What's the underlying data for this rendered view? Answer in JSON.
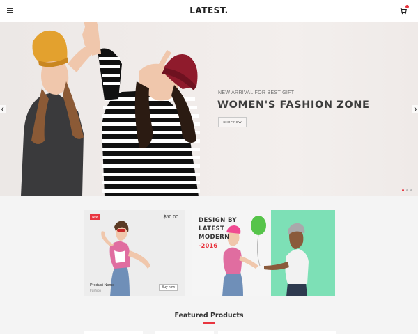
{
  "header": {
    "brand": "LATEST.",
    "menu_icon": "hamburger-menu-icon",
    "cart_icon": "shopping-cart-icon",
    "accent_color": "#e8353f"
  },
  "hero": {
    "subtitle": "NEW ARRIVAL FOR BEST GIFT",
    "title": "WOMEN'S FASHION ZONE",
    "button_label": "SHOP NOW",
    "prev_icon": "chevron-left-icon",
    "next_icon": "chevron-right-icon",
    "slides_count": 3,
    "active_slide": 1
  },
  "product_card": {
    "badge": "New",
    "price": "$50.00",
    "name": "Product Name",
    "category": "Fashion",
    "button_label": "Buy now"
  },
  "promo_card": {
    "line1": "DESIGN BY",
    "line2": "LATEST",
    "line3": "MODERN",
    "line4": "-2016"
  },
  "featured": {
    "heading": "Featured Products"
  }
}
